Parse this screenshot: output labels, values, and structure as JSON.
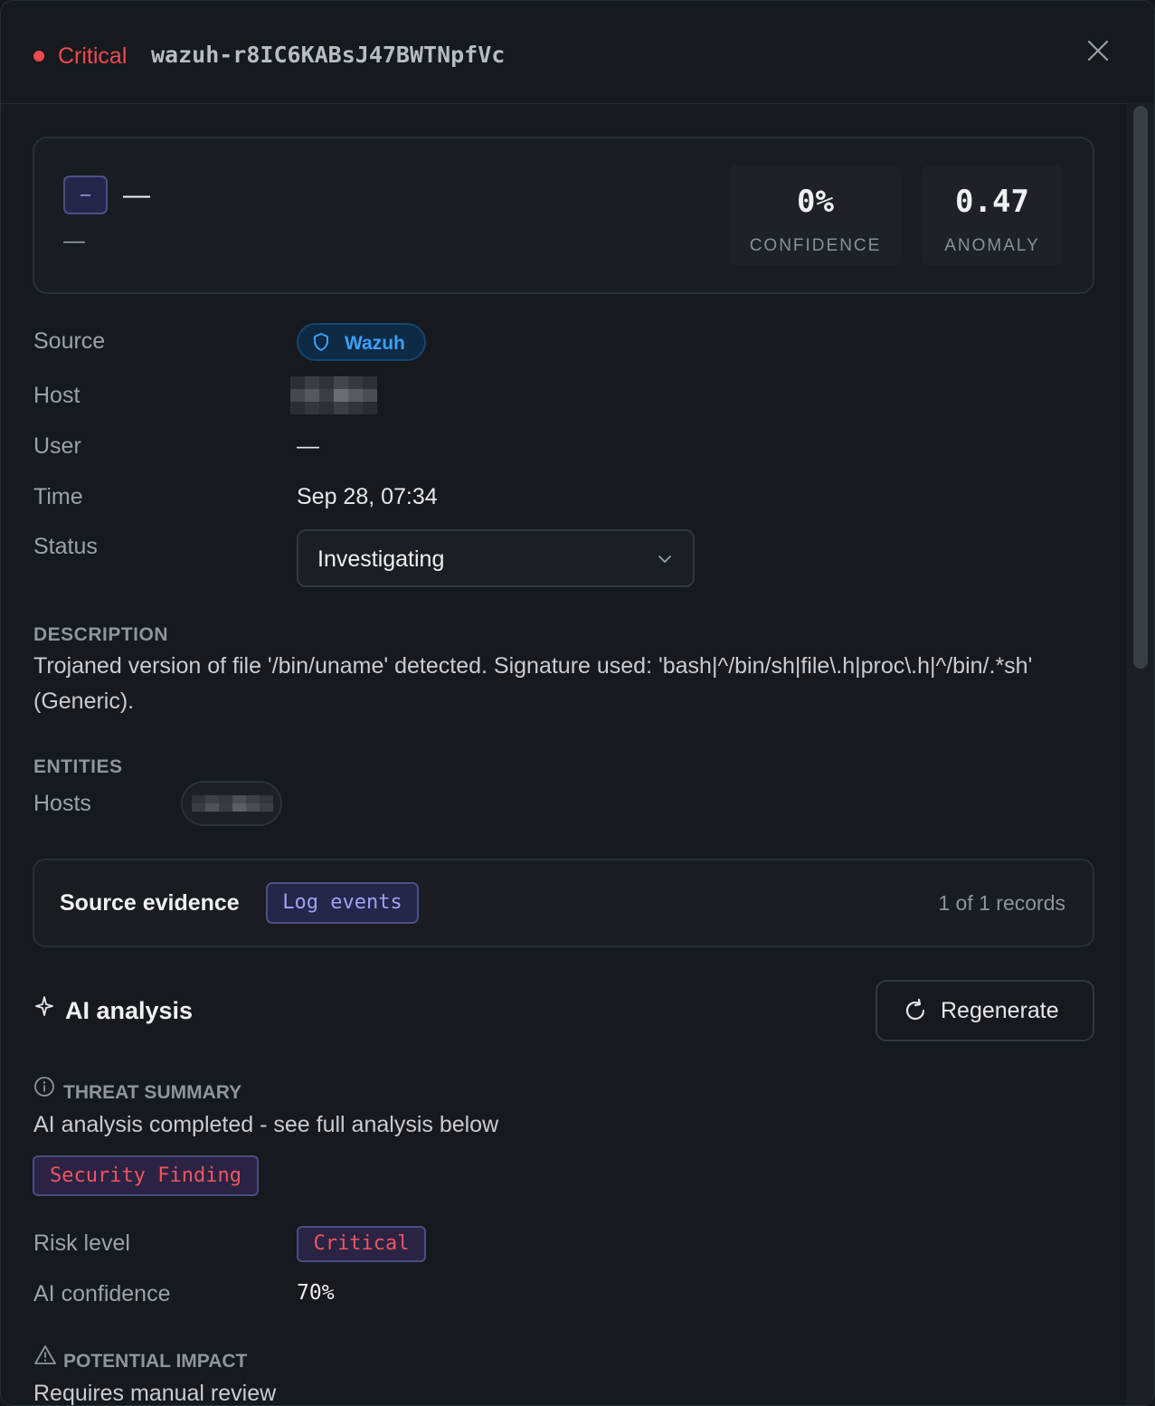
{
  "header": {
    "severity": "Critical",
    "alert_id": "wazuh-r8IC6KABsJ47BWTNpfVc",
    "severity_color": "#f0494f"
  },
  "summary_card": {
    "tag": "–",
    "title": "—",
    "subtitle": "—",
    "metrics": [
      {
        "value": "0%",
        "label": "CONFIDENCE"
      },
      {
        "value": "0.47",
        "label": "ANOMALY"
      }
    ]
  },
  "details": {
    "source_label": "Source",
    "source_value": "Wazuh",
    "source_icon": "shield-icon",
    "host_label": "Host",
    "user_label": "User",
    "user_value": "—",
    "time_label": "Time",
    "time_value": "Sep 28, 07:34",
    "status_label": "Status",
    "status_value": "Investigating"
  },
  "description": {
    "heading": "DESCRIPTION",
    "text": "Trojaned version of file '/bin/uname' detected. Signature used: 'bash|^/bin/sh|file\\.h|proc\\.h|^/bin/.*sh' (Generic)."
  },
  "entities": {
    "heading": "ENTITIES",
    "hosts_label": "Hosts"
  },
  "evidence": {
    "title": "Source evidence",
    "tag": "Log events",
    "count": "1 of 1 records"
  },
  "ai": {
    "title": "AI analysis",
    "regenerate_label": "Regenerate",
    "threat_summary_heading": "THREAT SUMMARY",
    "threat_summary_text": "AI analysis completed - see full analysis below",
    "finding_tag": "Security Finding",
    "risk_label": "Risk level",
    "risk_value": "Critical",
    "confidence_label": "AI confidence",
    "confidence_value": "70%",
    "impact_heading": "POTENTIAL IMPACT",
    "impact_text": "Requires manual review"
  }
}
